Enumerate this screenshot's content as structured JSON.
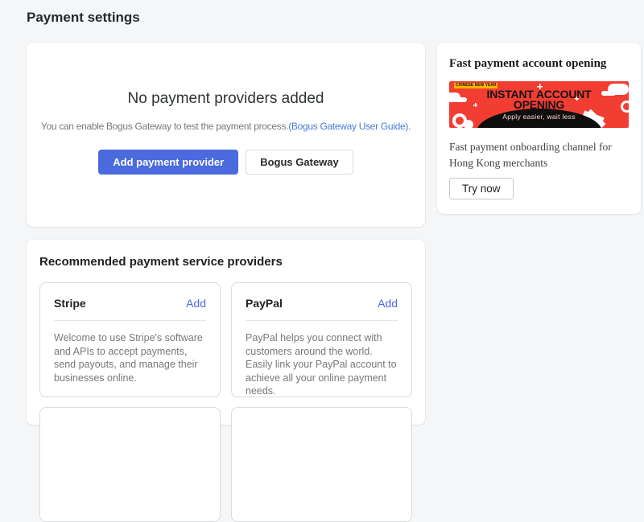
{
  "page": {
    "title": "Payment settings"
  },
  "colors": {
    "accent_blue": "#4b6ade",
    "link_blue": "#4a7bd8",
    "banner_red": "#f23d33",
    "badge_yellow": "#ffb300",
    "page_bg": "#f5f6f7"
  },
  "empty_state": {
    "title": "No payment providers added",
    "description": "You can enable Bogus Gateway to test the payment process.",
    "link_text": "(Bogus Gateway User Guide).",
    "primary_button": "Add payment provider",
    "secondary_button": "Bogus Gateway"
  },
  "promo": {
    "title": "Fast payment account opening",
    "banner": {
      "badge": "CHINESE NEW YEAR",
      "headline_line1": "INSTANT ACCOUNT",
      "headline_line2": "OPENING",
      "tagline": "Apply easier, wait less"
    },
    "description": "Fast payment onboarding channel for Hong Kong merchants",
    "button": "Try now"
  },
  "recommended": {
    "title": "Recommended payment service providers",
    "providers": [
      {
        "name": "Stripe",
        "action": "Add",
        "description": "Welcome to use Stripe's software and APIs to accept payments, send payouts, and manage their businesses online."
      },
      {
        "name": "PayPal",
        "action": "Add",
        "description": "PayPal helps you connect with customers around the world. Easily link your PayPal account to achieve all your online payment needs."
      }
    ]
  }
}
